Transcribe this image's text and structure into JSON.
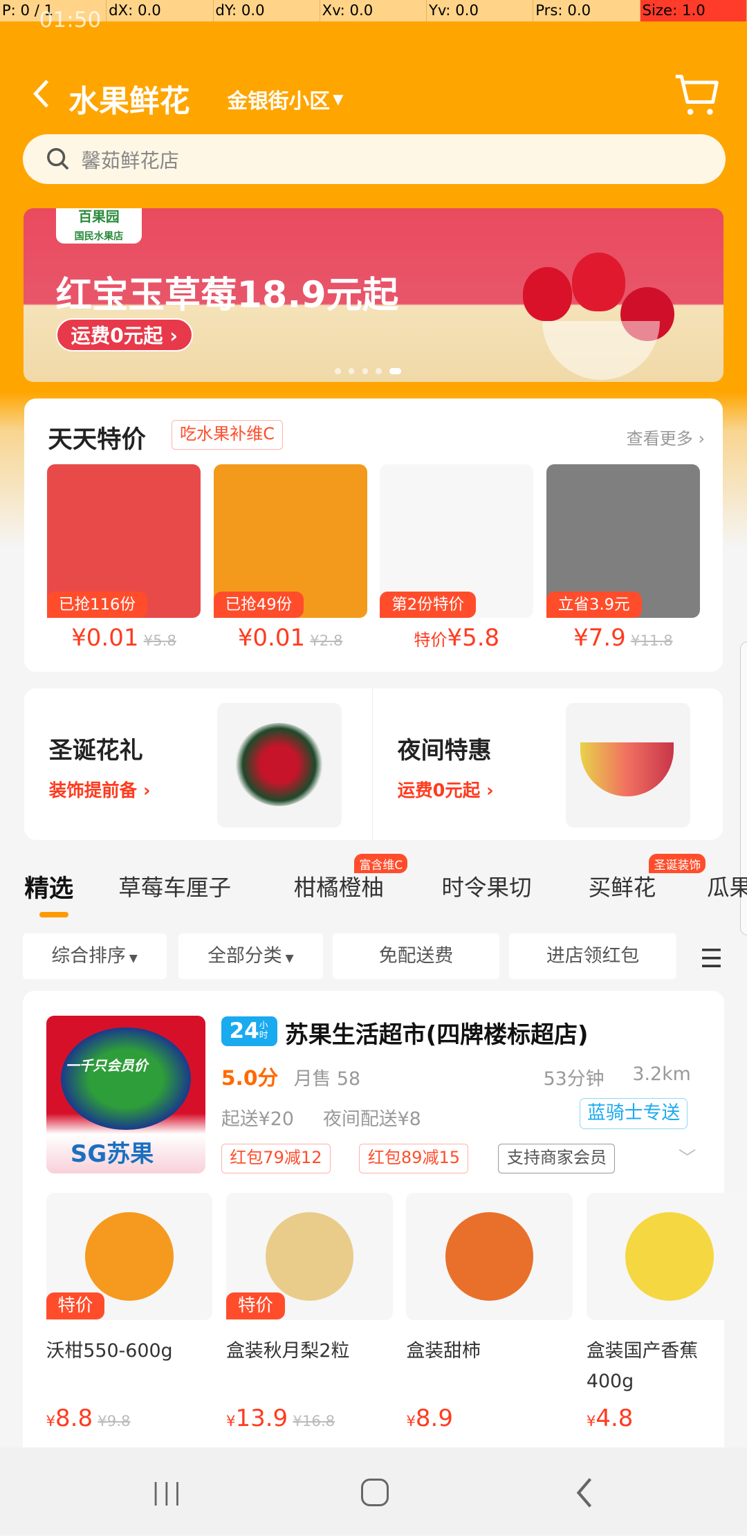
{
  "debug_bar": [
    "P: 0 / 1",
    "dX: 0.0",
    "dY: 0.0",
    "Xv: 0.0",
    "Yv: 0.0",
    "Prs: 0.0",
    "Size: 1.0"
  ],
  "status": {
    "time": "01:50"
  },
  "header": {
    "title": "水果鲜花",
    "location": "金银街小区",
    "back_icon": "chevron-left-icon",
    "cart_icon": "cart-icon"
  },
  "search": {
    "placeholder": "馨茹鲜花店"
  },
  "banner": {
    "logo": "百果园",
    "logo_sub": "国民水果店",
    "headline": "红宝玉草莓18.9元起",
    "cta": "运费0元起",
    "slides": 5,
    "active_slide": 5
  },
  "daily": {
    "title": "天天特价",
    "tag": "吃水果补维C",
    "more": "查看更多",
    "items": [
      {
        "badge": "已抢116份",
        "prefix": "",
        "price": "¥0.01",
        "old": "¥5.8",
        "color": "#e84a4a"
      },
      {
        "badge": "已抢49份",
        "prefix": "",
        "price": "¥0.01",
        "old": "¥2.8",
        "color": "#f39a1c"
      },
      {
        "badge": "第2份特价",
        "prefix": "特价",
        "price": "¥5.8",
        "old": "",
        "color": "#f7f7f7"
      },
      {
        "badge": "立省3.9元",
        "prefix": "",
        "price": "¥7.9",
        "old": "¥11.8",
        "color": "#7f7f7f"
      }
    ]
  },
  "promos": [
    {
      "title": "圣诞花礼",
      "sub": "装饰提前备"
    },
    {
      "title": "夜间特惠",
      "sub": "运费0元起"
    }
  ],
  "tabs": [
    {
      "label": "精选",
      "badge": ""
    },
    {
      "label": "草莓车厘子",
      "badge": ""
    },
    {
      "label": "柑橘橙柚",
      "badge": "富含维C"
    },
    {
      "label": "时令果切",
      "badge": ""
    },
    {
      "label": "买鲜花",
      "badge": "圣诞装饰"
    },
    {
      "label": "瓜果",
      "badge": ""
    }
  ],
  "filters": [
    "综合排序",
    "全部分类",
    "免配送费",
    "进店领红包"
  ],
  "store": {
    "hours_badge": "24",
    "hours_unit": "小时",
    "name": "苏果生活超市(四牌楼标超店)",
    "rating": "5.0分",
    "monthly": "月售 58",
    "time": "53分钟",
    "distance": "3.2km",
    "min_order": "起送¥20",
    "night_fee": "夜间配送¥8",
    "delivery": "蓝骑士专送",
    "logo": "SG苏果",
    "logo_banner": "一千只会员价",
    "tags": [
      "红包79减12",
      "红包89减15",
      "支持商家会员"
    ],
    "products": [
      {
        "name": "沃柑550-600g",
        "price": "8.8",
        "old": "¥9.8",
        "badge": "特价",
        "color": "#f59a1e"
      },
      {
        "name": "盒装秋月梨2粒",
        "price": "13.9",
        "old": "¥16.8",
        "badge": "特价",
        "color": "#e9cc8a"
      },
      {
        "name": "盒装甜柿",
        "price": "8.9",
        "old": "",
        "badge": "",
        "color": "#e8702a"
      },
      {
        "name": "盒装国产香蕉400g",
        "price": "4.8",
        "old": "",
        "badge": "",
        "color": "#f5d742"
      }
    ]
  },
  "colors": {
    "brand": "#ffa500",
    "price": "#ff3b1f",
    "delivery": "#1aaaf0"
  }
}
